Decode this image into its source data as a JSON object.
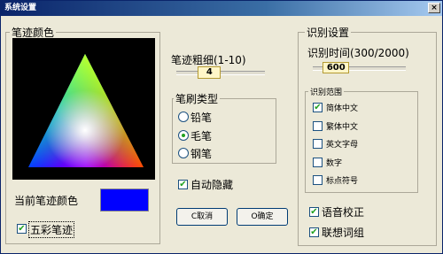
{
  "window": {
    "title": "系统设置",
    "close_label": "×"
  },
  "trace_color": {
    "group_title": "笔迹颜色",
    "current_label": "当前笔迹颜色",
    "current_color": "#0000ff",
    "rainbow_label": "五彩笔迹",
    "rainbow_checked": true
  },
  "pen_width": {
    "label": "笔迹粗细(1-10)",
    "value": "4",
    "fraction": 0.33
  },
  "brush_type": {
    "group_title": "笔刷类型",
    "options": [
      {
        "label": "铅笔",
        "selected": false
      },
      {
        "label": "毛笔",
        "selected": true
      },
      {
        "label": "钢笔",
        "selected": false
      }
    ]
  },
  "auto_hide": {
    "label": "自动隐藏",
    "checked": true
  },
  "buttons": {
    "cancel": "C取消",
    "ok": "O确定"
  },
  "recognition": {
    "group_title": "识别设置",
    "time_label": "识别时间(300/2000)",
    "time_value": "600",
    "time_fraction": 0.15,
    "range_title": "识别范围",
    "range_items": [
      {
        "label": "简体中文",
        "checked": true
      },
      {
        "label": "繁体中文",
        "checked": false
      },
      {
        "label": "英文字母",
        "checked": false
      },
      {
        "label": "数字",
        "checked": false
      },
      {
        "label": "标点符号",
        "checked": false
      }
    ],
    "voice_label": "语音校正",
    "voice_checked": true,
    "assoc_label": "联想词组",
    "assoc_checked": true
  }
}
